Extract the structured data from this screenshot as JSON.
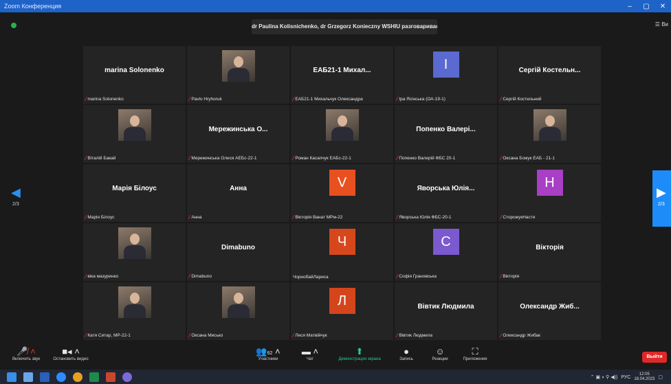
{
  "window": {
    "title": "Zoom Конференция",
    "controls": [
      "–",
      "▢",
      "✕"
    ]
  },
  "header": {
    "speaking": "dr Paulina Kolisnichenko, dr Grzegorz Konieczny WSHIU разговаривает...",
    "view_label": "☰ Ви"
  },
  "pager": {
    "left": "2/3",
    "right": "2/3"
  },
  "tiles": [
    {
      "kind": "name",
      "display": "marina Solonenko",
      "label": "marina Solonenko",
      "muted": true
    },
    {
      "kind": "photo",
      "display": "",
      "label": "Pavlo Hryhoruk",
      "muted": true
    },
    {
      "kind": "name",
      "display": "ЕАБ21-1 Михал...",
      "label": "ЕАБ21-1 Михальчук Олександра",
      "muted": true
    },
    {
      "kind": "avatar",
      "display": "I",
      "color": "#5b6ad0",
      "label": "Іра Ясінська (ОА-19-1)",
      "muted": true
    },
    {
      "kind": "name",
      "display": "Сергій Костельн...",
      "label": "Сергій Костельний",
      "muted": true
    },
    {
      "kind": "photo",
      "display": "",
      "label": "Віталій Бакай",
      "muted": true
    },
    {
      "kind": "name",
      "display": "Мережинська О...",
      "label": "Мережинська Олеся АЕБс-22-1",
      "muted": true
    },
    {
      "kind": "photo",
      "display": "",
      "label": "Роман Касапчук ЕАБс-22-1",
      "muted": true
    },
    {
      "kind": "name",
      "display": "Попенко Валері...",
      "label": "Попенко Валерій ФБС 20-1",
      "muted": true
    },
    {
      "kind": "photo",
      "display": "",
      "label": "Оксана Божук ЕАБ - 21-1",
      "muted": true
    },
    {
      "kind": "name",
      "display": "Марія Білоус",
      "label": "Марія Білоус",
      "muted": true
    },
    {
      "kind": "name",
      "display": "Анна",
      "label": "Анна",
      "muted": true
    },
    {
      "kind": "avatar",
      "display": "V",
      "color": "#e8501f",
      "label": "Вікторія Ванат МРм-22",
      "muted": true
    },
    {
      "kind": "name",
      "display": "Яворська Юлія...",
      "label": "Яворська Юлія ФБС-20-1",
      "muted": true
    },
    {
      "kind": "avatar",
      "display": "H",
      "color": "#a93fc4",
      "label": "СторожукНастя",
      "muted": true
    },
    {
      "kind": "photo",
      "display": "",
      "label": "віка мазуренко",
      "muted": true
    },
    {
      "kind": "name",
      "display": "Dimabuno",
      "label": "Dimabuno",
      "muted": true
    },
    {
      "kind": "avatar",
      "display": "Ч",
      "color": "#d6471c",
      "label": "ЧорнобайЛариса",
      "muted": false
    },
    {
      "kind": "avatar",
      "display": "C",
      "color": "#7b59cf",
      "label": "Софія Грановська",
      "muted": true
    },
    {
      "kind": "name",
      "display": "Вікторія",
      "label": "Вікторія",
      "muted": true
    },
    {
      "kind": "photo",
      "display": "",
      "label": "Катя Ситар, МР-22-1",
      "muted": true
    },
    {
      "kind": "photo",
      "display": "",
      "label": "Оксана Мисько",
      "muted": true
    },
    {
      "kind": "avatar",
      "display": "Л",
      "color": "#d4451c",
      "label": "Леся Матвійчук",
      "muted": true
    },
    {
      "kind": "name",
      "display": "Вівтик Людмила",
      "label": "Вівтик Людмила",
      "muted": true
    },
    {
      "kind": "name",
      "display": "Олександр Жиб...",
      "label": "Олександр Жибак",
      "muted": true
    }
  ],
  "toolbar": {
    "unmute": "Включить звук",
    "stop_video": "Остановить видео",
    "participants": "Участники",
    "participants_count": "62",
    "chat": "Чат",
    "share": "Демонстрация экрана",
    "record": "Запись",
    "reactions": "Реакции",
    "apps": "Приложения",
    "end": "Выйти"
  },
  "taskbar": {
    "lang": "РУС",
    "time": "12:05",
    "date": "18.04.2023"
  },
  "colors": {
    "accent": "#1d8cf8",
    "titlebar": "#1e63c8",
    "share_green": "#23d18b",
    "end_red": "#e02828",
    "mic_muted": "#e0322e"
  }
}
